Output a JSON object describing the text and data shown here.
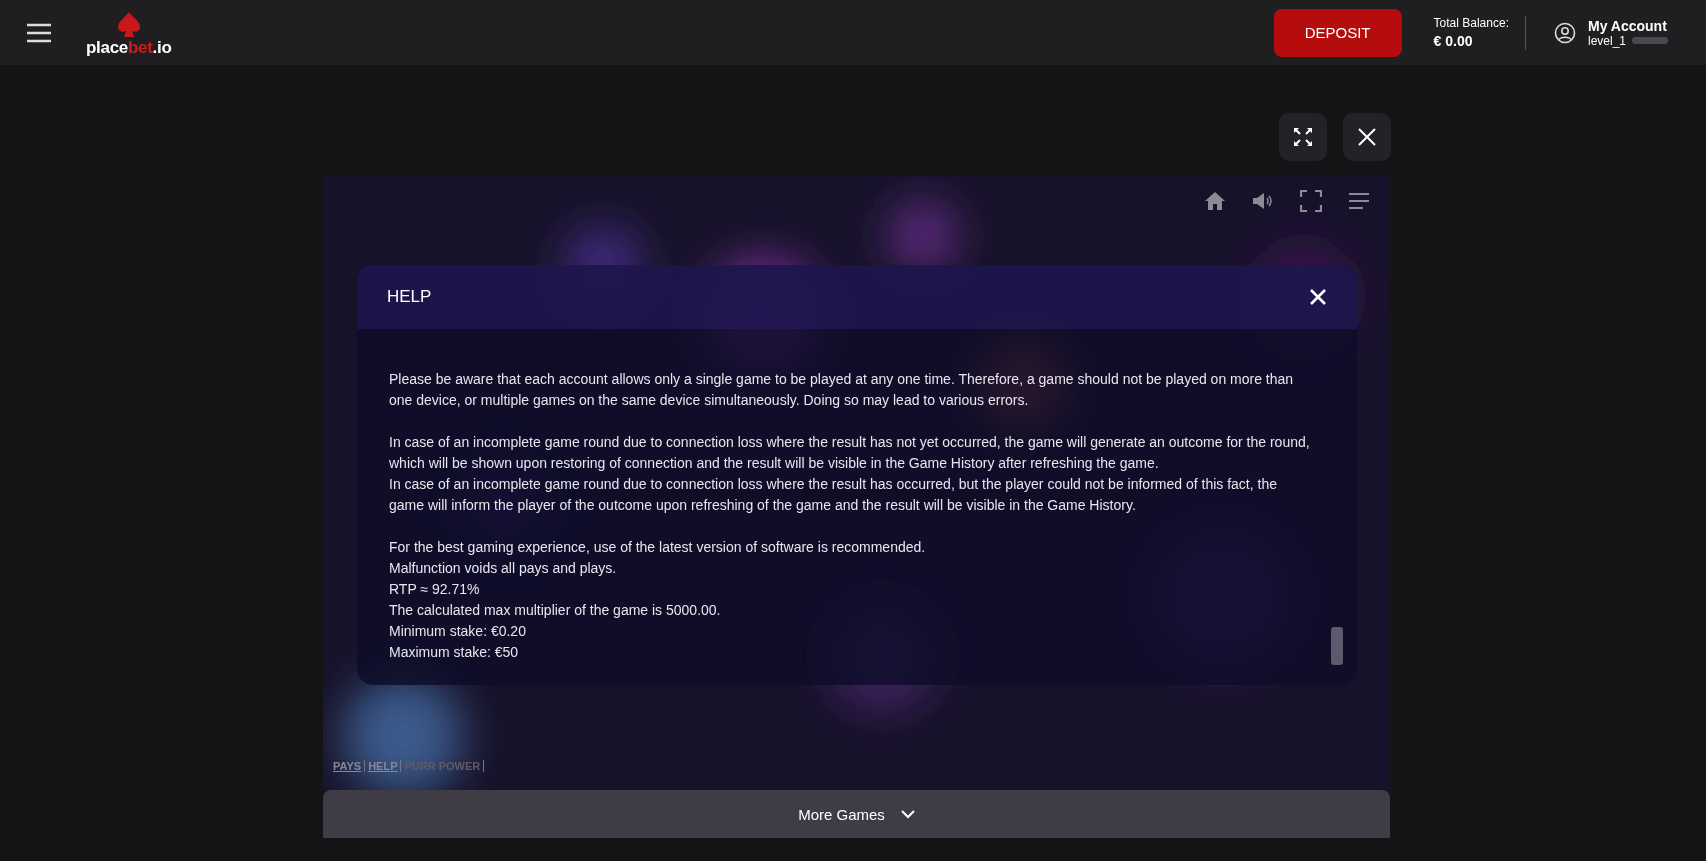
{
  "header": {
    "logo": [
      "place",
      "bet",
      ".io"
    ],
    "deposit_button": "DEPOSIT",
    "balance_label": "Total Balance:",
    "balance_value": "€ 0.00",
    "account_name": "My Account",
    "account_level": "level_1"
  },
  "help_dialog": {
    "title": "HELP",
    "sections": [
      [
        "Please be aware that each account allows only a single game to be played at any one time. Therefore, a game should not be played on more than one device, or multiple games on the same device simultaneously. Doing so may lead to various errors."
      ],
      [
        "In case of an incomplete game round due to connection loss where the result has not yet occurred, the game will generate an outcome for the round, which will be shown upon restoring of connection and the result will be visible in the Game History after refreshing the game.",
        "In case of an incomplete game round due to connection loss where the result has occurred, but the player could not be informed of this fact, the game will inform the player of the outcome upon refreshing of the game and the result will be visible in the Game History."
      ],
      [
        "For the best gaming experience, use of the latest version of software is recommended.",
        "Malfunction voids all pays and plays.",
        "RTP ≈ 92.71%",
        "The calculated max multiplier of the game is 5000.00.",
        "Minimum stake: €0.20",
        "Maximum stake: €50"
      ]
    ]
  },
  "footer_links": [
    {
      "label": "PAYS",
      "disabled": false
    },
    {
      "label": "HELP",
      "disabled": false
    },
    {
      "label": "PURR POWER",
      "disabled": true
    }
  ],
  "more_games": "More Games"
}
